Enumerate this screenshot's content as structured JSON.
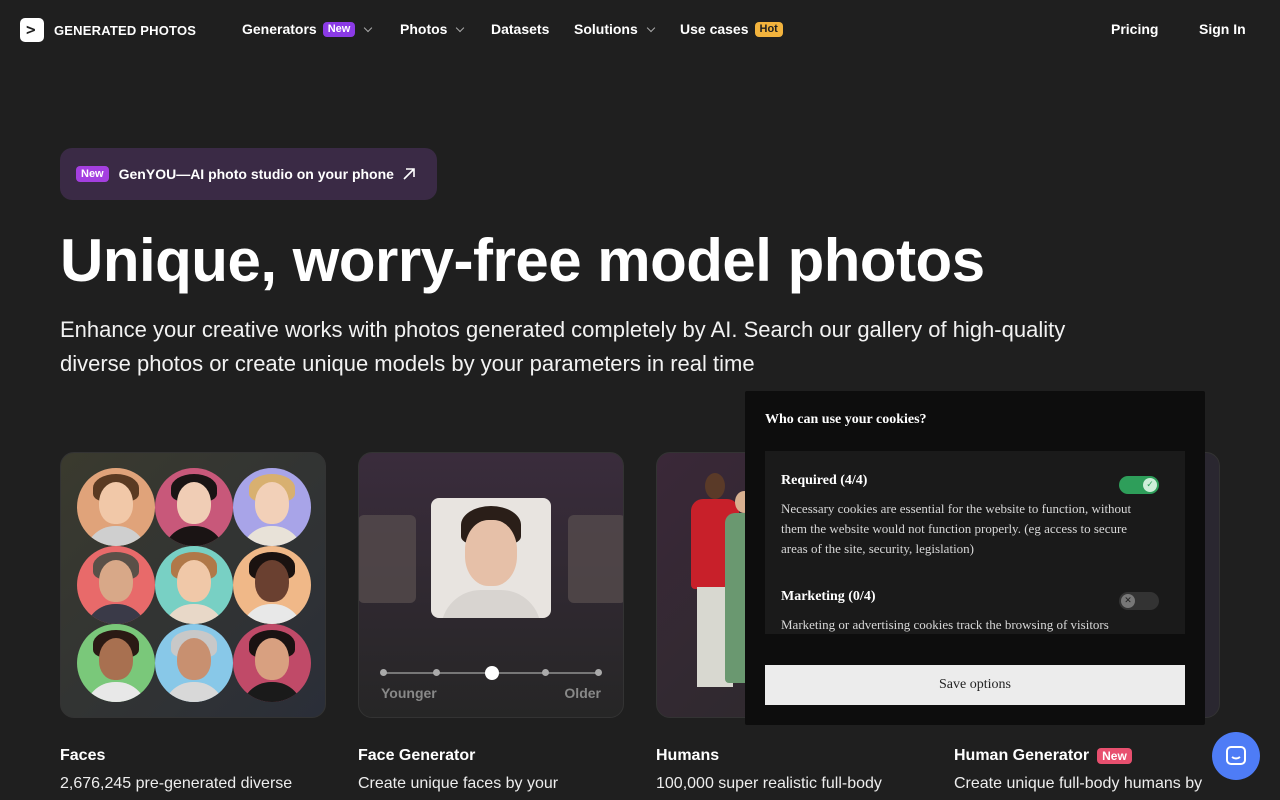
{
  "nav": {
    "logo_text": "GENERATED PHOTOS",
    "items": [
      {
        "label": "Generators",
        "badge": "New"
      },
      {
        "label": "Photos"
      },
      {
        "label": "Datasets"
      },
      {
        "label": "Solutions"
      },
      {
        "label": "Use cases",
        "badge": "Hot"
      }
    ],
    "pricing": "Pricing",
    "sign_in": "Sign In"
  },
  "promo": {
    "badge": "New",
    "text": "GenYOU—AI photo studio on your phone"
  },
  "hero": {
    "title": "Unique, worry-free model photos",
    "lead": "Enhance your creative works with photos generated completely by AI. Search our gallery of high-quality diverse photos or create unique models by your parameters in real time"
  },
  "cards": [
    {
      "title": "Faces",
      "desc": "2,676,245 pre-generated diverse"
    },
    {
      "title": "Face Generator",
      "desc": "Create unique faces by your",
      "slider_left": "Younger",
      "slider_right": "Older"
    },
    {
      "title": "Humans",
      "desc": "100,000 super realistic full-body"
    },
    {
      "title": "Human Generator",
      "badge": "New",
      "desc": "Create unique full-body humans by"
    }
  ],
  "cookie": {
    "title": "Who can use your cookies?",
    "required_title": "Required (4/4)",
    "required_body": "Necessary cookies are essential for the website to function, without them the website would not function properly. (eg access to secure areas of the site, security, legislation)",
    "marketing_title": "Marketing (0/4)",
    "marketing_body": "Marketing or advertising cookies track the browsing of visitors",
    "save": "Save options"
  },
  "colors": {
    "accent_purple": "#8b3ae6",
    "hot": "#f2b33d",
    "toggle_on": "#2e9e5a",
    "chat": "#4e7cf6"
  }
}
